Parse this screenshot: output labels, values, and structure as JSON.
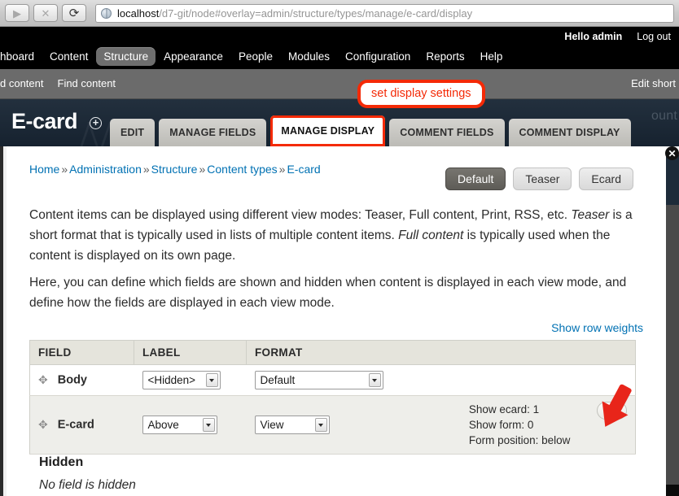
{
  "browser": {
    "forward_icon": "forward-arrow-icon",
    "stop_label": "✕",
    "reload_label": "⟳",
    "forward_label": "▶",
    "url_host": "localhost",
    "url_path": "/d7-git/node#overlay=admin/structure/types/manage/e-card/display",
    "url_full": "localhost/d7-git/node#overlay=admin/structure/types/manage/e-card/display"
  },
  "toolbar": {
    "greeting_prefix": "Hello ",
    "greeting_user": "admin",
    "logout_label": "Log out",
    "items": [
      {
        "label": "hboard",
        "active": false
      },
      {
        "label": "Content",
        "active": false
      },
      {
        "label": "Structure",
        "active": true
      },
      {
        "label": "Appearance",
        "active": false
      },
      {
        "label": "People",
        "active": false
      },
      {
        "label": "Modules",
        "active": false
      },
      {
        "label": "Configuration",
        "active": false
      },
      {
        "label": "Reports",
        "active": false
      },
      {
        "label": "Help",
        "active": false
      }
    ]
  },
  "shortcuts": {
    "items": [
      {
        "label": "d content"
      },
      {
        "label": "Find content"
      }
    ],
    "edit_label": "Edit short"
  },
  "overlay": {
    "title": "E-card",
    "plus_icon": "plus-circle-icon",
    "ghost_text": "ount",
    "close_label": "✕",
    "tabs": [
      {
        "label": "EDIT",
        "active": false,
        "highlight": false
      },
      {
        "label": "MANAGE FIELDS",
        "active": false,
        "highlight": false
      },
      {
        "label": "MANAGE DISPLAY",
        "active": true,
        "highlight": true
      },
      {
        "label": "COMMENT FIELDS",
        "active": false,
        "highlight": false
      },
      {
        "label": "COMMENT DISPLAY",
        "active": false,
        "highlight": false
      }
    ]
  },
  "breadcrumb": {
    "separator": "»",
    "items": [
      "Home",
      "Administration",
      "Structure",
      "Content types",
      "E-card"
    ]
  },
  "view_modes": [
    {
      "label": "Default",
      "active": true
    },
    {
      "label": "Teaser",
      "active": false
    },
    {
      "label": "Ecard",
      "active": false
    }
  ],
  "intro": {
    "p1_a": "Content items can be displayed using different view modes: Teaser, Full content, Print, RSS, etc. ",
    "p1_em1": "Teaser",
    "p1_b": " is a short format that is typically used in lists of multiple content items. ",
    "p1_em2": "Full content",
    "p1_c": " is typically used when the content is displayed on its own page.",
    "p2": "Here, you can define which fields are shown and hidden when content is displayed in each view mode, and define how the fields are displayed in each view mode."
  },
  "show_row_weights": "Show row weights",
  "table": {
    "headers": [
      "FIELD",
      "LABEL",
      "FORMAT"
    ],
    "rows": [
      {
        "drag_icon": "drag-handle-icon",
        "field": "Body",
        "label_value": "<Hidden>",
        "format_value": "Default",
        "summary": [],
        "has_gear": false
      },
      {
        "drag_icon": "drag-handle-icon",
        "field": "E-card",
        "label_value": "Above",
        "format_value": "View",
        "summary": [
          "Show ecard: 1",
          "Show form: 0",
          "Form position: below"
        ],
        "has_gear": true,
        "gear_icon": "gear-icon"
      }
    ]
  },
  "hidden_section": {
    "heading": "Hidden",
    "note": "No field is hidden"
  },
  "annotations": {
    "pill_label": "set display settings",
    "arrow_icon": "red-arrow-icon",
    "accent_color": "#f42a07"
  }
}
